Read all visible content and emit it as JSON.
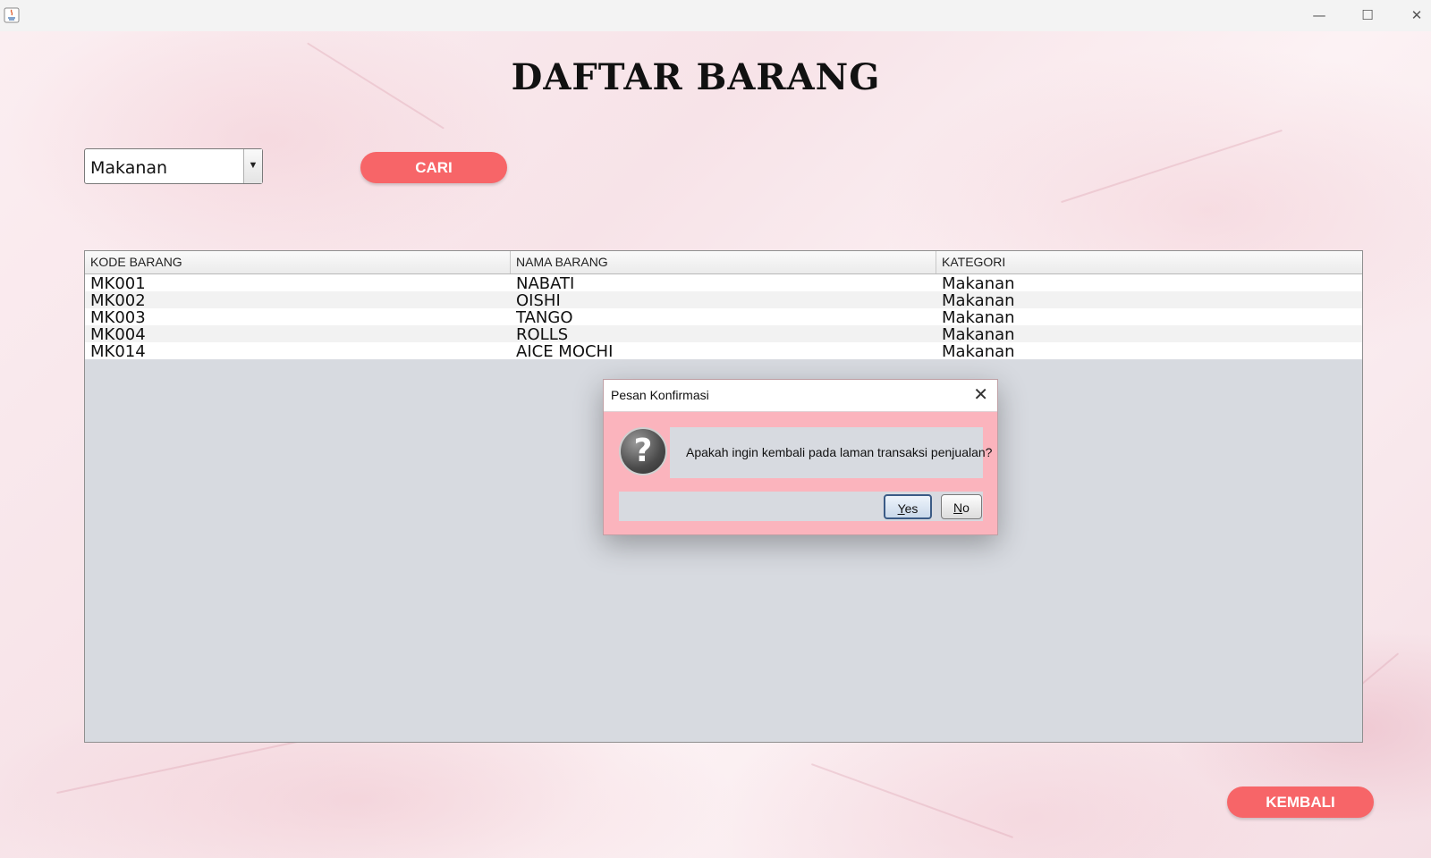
{
  "window": {
    "minimize_glyph": "—",
    "maximize_glyph": "☐",
    "close_glyph": "✕"
  },
  "page": {
    "title": "DAFTAR BARANG"
  },
  "filter": {
    "category_selected": "Makanan",
    "search_button": "CARI"
  },
  "table": {
    "columns": [
      "KODE BARANG",
      "NAMA  BARANG",
      "KATEGORI"
    ],
    "rows": [
      [
        "MK001",
        "NABATI",
        "Makanan"
      ],
      [
        "MK002",
        "OISHI",
        "Makanan"
      ],
      [
        "MK003",
        "TANGO",
        "Makanan"
      ],
      [
        "MK004",
        "ROLLS",
        "Makanan"
      ],
      [
        "MK014",
        "AICE MOCHI",
        "Makanan"
      ]
    ]
  },
  "footer": {
    "back_button": "KEMBALI"
  },
  "dialog": {
    "title": "Pesan Konfirmasi",
    "message": "Apakah ingin kembali pada laman transaksi penjualan?",
    "yes_mnemonic": "Y",
    "yes_rest": "es",
    "no_mnemonic": "N",
    "no_rest": "o",
    "close_glyph": "✕",
    "icon_glyph": "?"
  },
  "colors": {
    "accent_button": "#f76568",
    "dialog_background": "#fbb4bd",
    "table_empty_area": "#d7dae0"
  }
}
